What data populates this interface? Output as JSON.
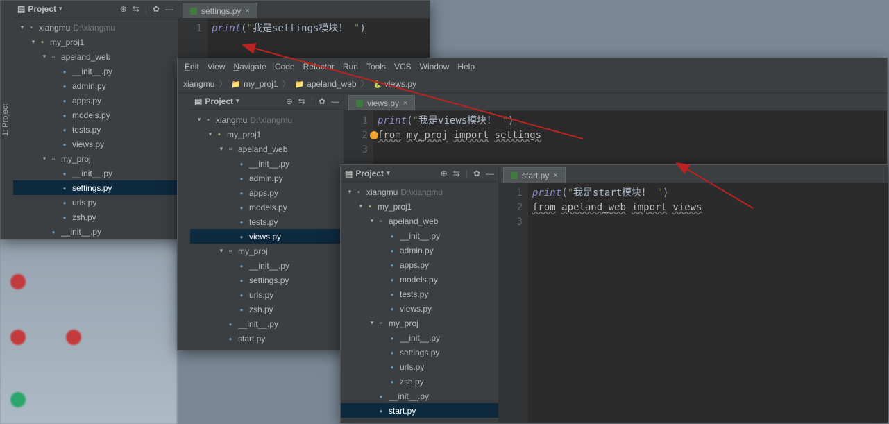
{
  "menubar": {
    "edit": "Edit",
    "view": "View",
    "navigate": "Navigate",
    "code": "Code",
    "refactor": "Refactor",
    "run": "Run",
    "tools": "Tools",
    "vcs": "VCS",
    "window": "Window",
    "help": "Help"
  },
  "proj_label": "1: Project",
  "proj_title": "Project",
  "crumb2": {
    "a": "xiangmu",
    "b": "my_proj1",
    "c": "apeland_web",
    "d": "views.py"
  },
  "ide1": {
    "tab": "settings.py",
    "tree_root": "xiangmu",
    "tree_root_hint": "D:\\xiangmu",
    "proj1": "my_proj1",
    "pkg1": "apeland_web",
    "f_init": "__init__.py",
    "f_admin": "admin.py",
    "f_apps": "apps.py",
    "f_models": "models.py",
    "f_tests": "tests.py",
    "f_views": "views.py",
    "proj2": "my_proj",
    "f_settings": "settings.py",
    "f_urls": "urls.py",
    "f_zsh": "zsh.py",
    "f_init2": "__init__.py",
    "code": {
      "ln1": "1",
      "print": "print",
      "lp": "(",
      "s1": "\"",
      "txt": "我是settings模块！ ",
      "s2": "\"",
      "rp": ")"
    }
  },
  "ide2": {
    "tab": "views.py",
    "tree_root": "xiangmu",
    "tree_root_hint": "D:\\xiangmu",
    "proj1": "my_proj1",
    "pkg1": "apeland_web",
    "f_init": "__init__.py",
    "f_admin": "admin.py",
    "f_apps": "apps.py",
    "f_models": "models.py",
    "f_tests": "tests.py",
    "f_views": "views.py",
    "proj2": "my_proj",
    "f_init2": "__init__.py",
    "f_settings": "settings.py",
    "f_urls": "urls.py",
    "f_zsh": "zsh.py",
    "f_init3": "__init__.py",
    "f_start": "start.py",
    "code": {
      "ln1": "1",
      "ln2": "2",
      "ln3": "3",
      "print": "print",
      "lp": "(",
      "s1": "\"",
      "txt": "我是views模块！ ",
      "s2": "\"",
      "rp": ")",
      "from": "from",
      "mod": "my_proj",
      "import": "import",
      "name": "settings"
    }
  },
  "ide3": {
    "tab": "start.py",
    "tree_root": "xiangmu",
    "tree_root_hint": "D:\\xiangmu",
    "proj1": "my_proj1",
    "pkg1": "apeland_web",
    "f_init": "__init__.py",
    "f_admin": "admin.py",
    "f_apps": "apps.py",
    "f_models": "models.py",
    "f_tests": "tests.py",
    "f_views": "views.py",
    "proj2": "my_proj",
    "f_init2": "__init__.py",
    "f_settings": "settings.py",
    "f_urls": "urls.py",
    "f_zsh": "zsh.py",
    "f_init3": "__init__.py",
    "f_start": "start.py",
    "code": {
      "ln1": "1",
      "ln2": "2",
      "ln3": "3",
      "print": "print",
      "lp": "(",
      "s1": "\"",
      "txt": "我是start模块！ ",
      "s2": "\"",
      "rp": ")",
      "from": "from",
      "mod": "apeland_web",
      "import": "import",
      "name": "views"
    }
  }
}
